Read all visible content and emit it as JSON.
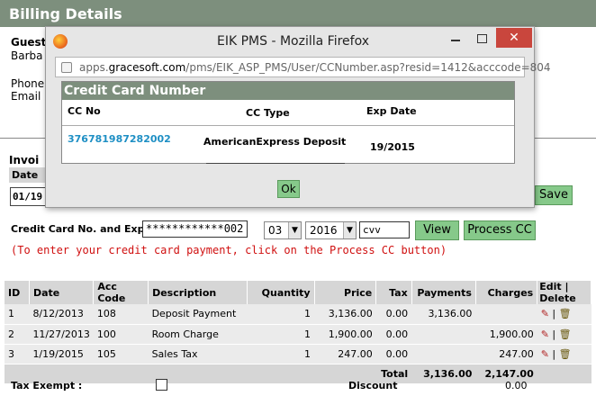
{
  "header": {
    "title": "Billing Details"
  },
  "guest": {
    "label": "Guest",
    "name_partial": "Barba",
    "phone_label": "Phone",
    "email_label": "Email"
  },
  "invoice": {
    "label_partial": "Invoi",
    "date_label": "Date",
    "date_value_partial": "01/19",
    "save_label": "Save"
  },
  "credit_card": {
    "label": "Credit Card No. and Exp Dt",
    "number_value": "************002",
    "month": "03",
    "year": "2016",
    "cvv_value": "cvv",
    "view_label": "View",
    "process_label": "Process CC",
    "note": "(To enter your credit card payment, click on the Process CC button)"
  },
  "table": {
    "headers": [
      "ID",
      "Date",
      "Acc Code",
      "Description",
      "Quantity",
      "Price",
      "Tax",
      "Payments",
      "Charges",
      "Edit | Delete"
    ],
    "rows": [
      {
        "id": "1",
        "date": "8/12/2013",
        "acc": "108",
        "desc": "Deposit Payment",
        "qty": "1",
        "price": "3,136.00",
        "tax": "0.00",
        "payments": "3,136.00",
        "charges": ""
      },
      {
        "id": "2",
        "date": "11/27/2013",
        "acc": "100",
        "desc": "Room Charge",
        "qty": "1",
        "price": "1,900.00",
        "tax": "0.00",
        "payments": "",
        "charges": "1,900.00"
      },
      {
        "id": "3",
        "date": "1/19/2015",
        "acc": "105",
        "desc": "Sales Tax",
        "qty": "1",
        "price": "247.00",
        "tax": "0.00",
        "payments": "",
        "charges": "247.00"
      }
    ],
    "total_label": "Total",
    "total_payments": "3,136.00",
    "total_charges": "2,147.00"
  },
  "footer": {
    "tax_exempt_label": "Tax Exempt :",
    "discount_label": "Discount",
    "discount_value": "0.00"
  },
  "popup": {
    "window_title": "EIK PMS - Mozilla Firefox",
    "url_prefix": "apps.",
    "url_domain": "gracesoft.com",
    "url_path": "/pms/EIK_ASP_PMS/User/CCNumber.asp?resid=1412&acccode=804",
    "heading": "Credit Card Number",
    "col_cc_no": "CC No",
    "col_cc_type": "CC Type",
    "col_exp_date": "Exp Date",
    "cc_no": "376781987282002",
    "cc_type": "AmericanExpress Deposit",
    "exp_date": "19/2015",
    "ok_label": "Ok"
  },
  "colors": {
    "header_bg": "#7d8f7d",
    "button_green": "#86c98a",
    "link_blue": "#1e8fc4",
    "note_red": "#d01010"
  },
  "icons": [
    "edit-pencil-icon",
    "delete-trash-icon",
    "firefox-icon",
    "page-icon"
  ]
}
